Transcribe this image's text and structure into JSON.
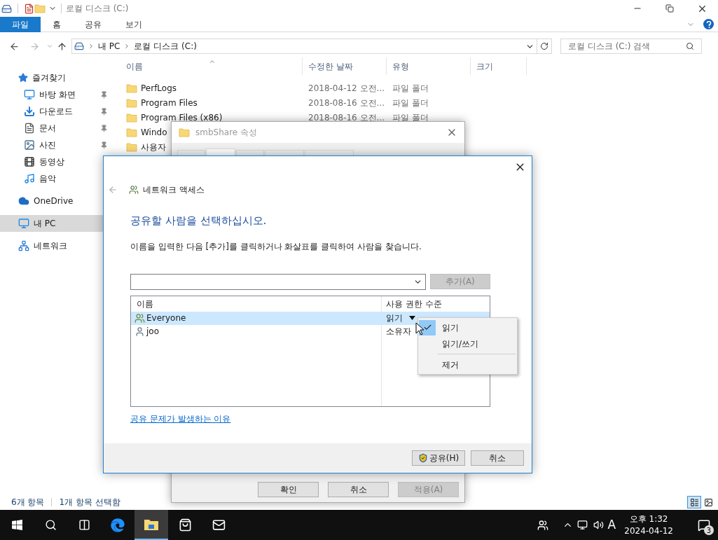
{
  "explorer": {
    "title": "로컬 디스크 (C:)",
    "ribbon_tabs": [
      {
        "label": "파일",
        "selected": true
      },
      {
        "label": "홈",
        "selected": false
      },
      {
        "label": "공유",
        "selected": false
      },
      {
        "label": "보기",
        "selected": false
      }
    ],
    "address": {
      "crumbs": [
        "내 PC",
        "로컬 디스크 (C:)"
      ]
    },
    "search": {
      "placeholder": "로컬 디스크 (C:) 검색"
    },
    "sidebar": {
      "items": [
        {
          "label": "즐겨찾기",
          "selected": false,
          "children": [
            {
              "label": "바탕 화면",
              "selected": false,
              "pinned": true
            },
            {
              "label": "다운로드",
              "selected": false,
              "pinned": true
            },
            {
              "label": "문서",
              "selected": false,
              "pinned": true
            },
            {
              "label": "사진",
              "selected": false,
              "pinned": true
            },
            {
              "label": "동영상",
              "selected": false,
              "pinned": false
            },
            {
              "label": "음악",
              "selected": false,
              "pinned": false
            }
          ]
        },
        {
          "label": "OneDrive",
          "selected": false
        },
        {
          "label": "내 PC",
          "selected": true
        },
        {
          "label": "네트워크",
          "selected": false
        }
      ]
    },
    "columns": [
      "이름",
      "수정한 날짜",
      "유형",
      "크기"
    ],
    "rows": [
      {
        "name": "PerfLogs",
        "modified": "2018-04-12 오전...",
        "type": "파일 폴더"
      },
      {
        "name": "Program Files",
        "modified": "2018-08-16 오전...",
        "type": "파일 폴더"
      },
      {
        "name": "Program Files (x86)",
        "modified": "2018-08-16 오전...",
        "type": "파일 폴더"
      },
      {
        "name": "Windo"
      },
      {
        "name": "사용자"
      }
    ],
    "status": [
      "6개 항목",
      "1개 항목 선택함"
    ]
  },
  "properties_dialog": {
    "title": "smbShare 속성",
    "tabs": [
      {
        "selected": false
      },
      {
        "selected": true
      },
      {
        "selected": false
      },
      {
        "selected": false
      },
      {
        "selected": false
      }
    ],
    "buttons": [
      {
        "label": "확인",
        "disabled": false
      },
      {
        "label": "취소",
        "disabled": false
      },
      {
        "label": "적용(A)",
        "disabled": true
      }
    ]
  },
  "share_dialog": {
    "title": "네트워크 액세스",
    "heading": "공유할 사람을 선택하십시오.",
    "instruction": "이름을 입력한 다음 [추가]를 클릭하거나 화살표를 클릭하여 사람을 찾습니다.",
    "add_button": {
      "label": "추가(A)",
      "disabled": true
    },
    "columns": [
      "이름",
      "사용 권한 수준"
    ],
    "rows": [
      {
        "name": "Everyone",
        "permission": "읽기",
        "kind": "group",
        "selected": true
      },
      {
        "name": "joo",
        "permission": "소유자",
        "kind": "user",
        "selected": false
      }
    ],
    "permission_menu": {
      "items": [
        {
          "label": "읽기",
          "checked": true
        },
        {
          "label": "읽기/쓰기",
          "checked": false
        }
      ],
      "actions": [
        "제거"
      ]
    },
    "help_link": "공유 문제가 발생하는 이유",
    "buttons": [
      {
        "label": "공유(H)",
        "kind": "admin"
      },
      {
        "label": "취소",
        "kind": "plain"
      }
    ]
  },
  "taskbar": {
    "apps": [
      {
        "selected": false
      },
      {
        "selected": false
      },
      {
        "selected": false
      },
      {
        "selected": true
      },
      {
        "selected": false
      },
      {
        "selected": false
      }
    ],
    "ime": "A",
    "time": "오후 1:32",
    "date": "2024-04-12",
    "notifications": "3"
  }
}
